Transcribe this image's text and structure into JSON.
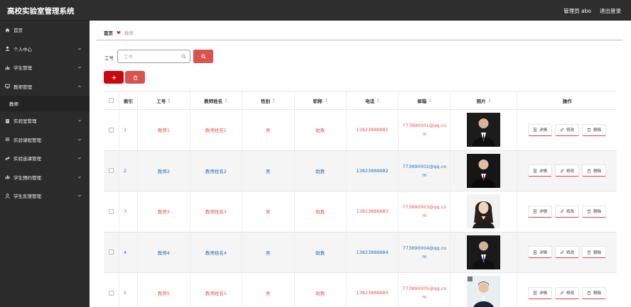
{
  "app": {
    "title": "高校实验室管理系统"
  },
  "header": {
    "user_label": "管理员 abo",
    "logout_label": "退出登录"
  },
  "sidebar": {
    "items": [
      {
        "label": "首页",
        "icon": "home-icon",
        "expandable": false
      },
      {
        "label": "个人中心",
        "icon": "user-icon",
        "expandable": true
      },
      {
        "label": "学生管理",
        "icon": "chart-icon",
        "expandable": true
      },
      {
        "label": "教师管理",
        "icon": "monitor-icon",
        "expandable": true,
        "expanded": true
      },
      {
        "label": "实验室管理",
        "icon": "clipboard-icon",
        "expandable": true
      },
      {
        "label": "实验课程管理",
        "icon": "list-icon",
        "expandable": true
      },
      {
        "label": "实验选课管理",
        "icon": "link-icon",
        "expandable": true
      },
      {
        "label": "学生预约管理",
        "icon": "chart-icon",
        "expandable": true
      },
      {
        "label": "学生反馈管理",
        "icon": "user-icon",
        "expandable": true
      }
    ],
    "sub_item": "教师"
  },
  "breadcrumb": {
    "home": "首页",
    "current": "教师"
  },
  "search": {
    "label": "工号",
    "placeholder": "工号"
  },
  "table": {
    "columns": [
      "",
      "索引",
      "工号",
      "教师姓名",
      "性别",
      "职称",
      "电话",
      "邮箱",
      "照片",
      "操作"
    ],
    "rows": [
      {
        "index": "1",
        "no": "教师1",
        "name": "教师姓名1",
        "sex": "男",
        "title": "助教",
        "phone": "13823888881",
        "email_a": "773890001@qq.co",
        "email_b": "m"
      },
      {
        "index": "2",
        "no": "教师2",
        "name": "教师姓名2",
        "sex": "男",
        "title": "助教",
        "phone": "13823888882",
        "email_a": "773890002@qq.co",
        "email_b": "m"
      },
      {
        "index": "3",
        "no": "教师3",
        "name": "教师姓名3",
        "sex": "男",
        "title": "助教",
        "phone": "13823888883",
        "email_a": "773890003@qq.co",
        "email_b": "m"
      },
      {
        "index": "4",
        "no": "教师4",
        "name": "教师姓名4",
        "sex": "男",
        "title": "助教",
        "phone": "13823888884",
        "email_a": "773890004@qq.co",
        "email_b": "m"
      },
      {
        "index": "5",
        "no": "教师5",
        "name": "教师姓名5",
        "sex": "男",
        "title": "助教",
        "phone": "13823888885",
        "email_a": "773890005@qq.co",
        "email_b": "m"
      }
    ],
    "actions": {
      "detail": "详情",
      "edit": "修改",
      "delete": "删除"
    }
  },
  "colors": {
    "sidebar_bg": "#2b2b2b",
    "topbar_bg": "#2e2e2e",
    "accent_red": "#d9534f",
    "row_red_text": "#e8564c",
    "row_blue_text": "#2d6db5"
  }
}
